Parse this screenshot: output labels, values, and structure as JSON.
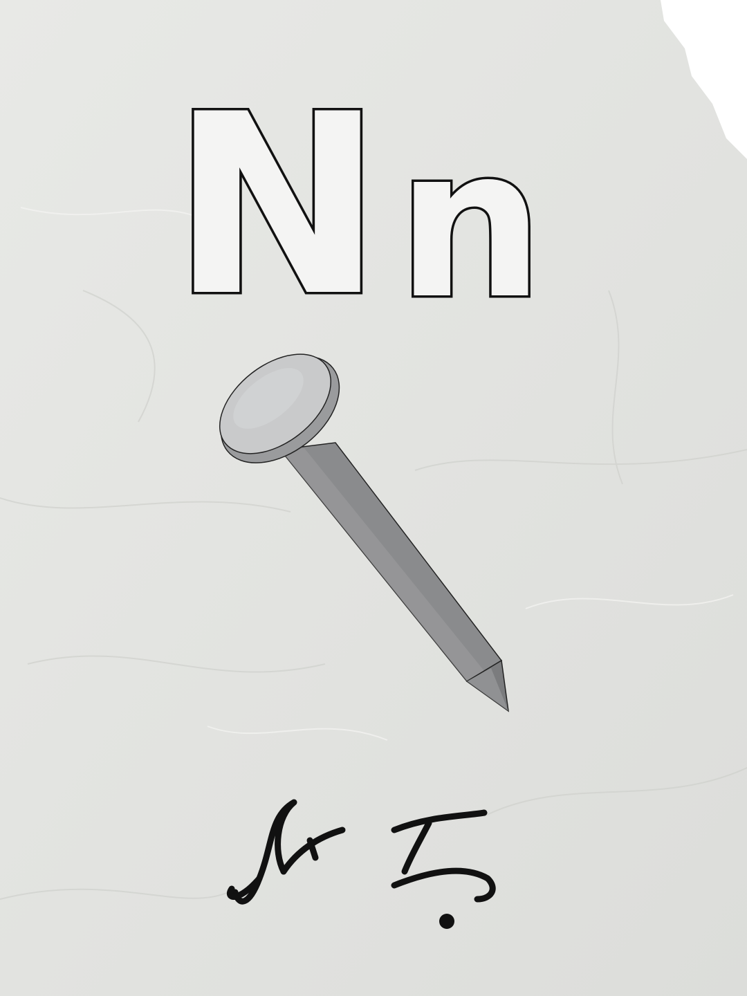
{
  "card": {
    "uppercase_letter": "N",
    "lowercase_letter": "n",
    "picture_icon": "nail-icon",
    "script_word_icon": "handwritten-script-word"
  },
  "colors": {
    "paper": "#e3e4e1",
    "ink": "#111111",
    "letter_fill": "#f4f4f3",
    "nail_metal": "#8a8b8d",
    "nail_head": "#c9cacb"
  }
}
